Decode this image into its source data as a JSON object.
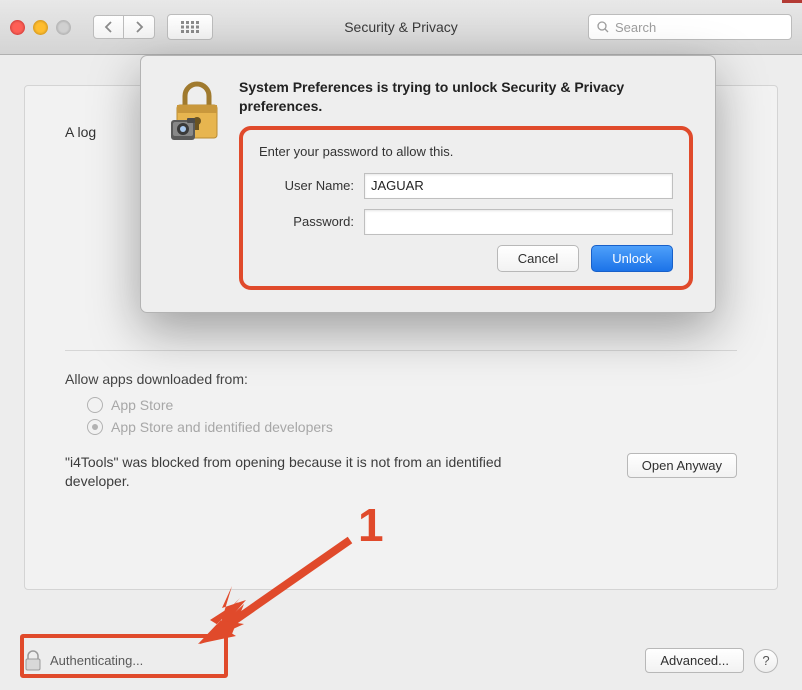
{
  "toolbar": {
    "title": "Security & Privacy",
    "search_placeholder": "Search"
  },
  "page": {
    "login_prefix": "A log",
    "allow_title": "Allow apps downloaded from:",
    "radio_appstore": "App Store",
    "radio_identified": "App Store and identified developers",
    "blocked_msg": "\"i4Tools\" was blocked from opening because it is not from an identified developer.",
    "open_anyway": "Open Anyway"
  },
  "footer": {
    "auth_text": "Authenticating...",
    "advanced": "Advanced...",
    "help": "?"
  },
  "dialog": {
    "heading": "System Preferences is trying to unlock Security & Privacy preferences.",
    "prompt": "Enter your password to allow this.",
    "user_label": "User Name:",
    "user_value": "JAGUAR",
    "pass_label": "Password:",
    "pass_value": "",
    "cancel": "Cancel",
    "unlock": "Unlock"
  },
  "annotation": {
    "number": "1"
  },
  "colors": {
    "accent": "#e04a2b",
    "primary_button": "#1c73e8"
  }
}
